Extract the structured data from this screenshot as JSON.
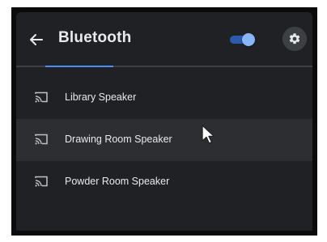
{
  "header": {
    "back_icon": "arrow-left-icon",
    "title": "Bluetooth",
    "bluetooth_enabled": true,
    "settings_icon": "gear-icon"
  },
  "colors": {
    "background": "#202124",
    "text": "#e8eaed",
    "accent": "#8ab4f8",
    "progress": "#4c8df6",
    "hover_row": "#2d2e31"
  },
  "devices": [
    {
      "label": "Library Speaker",
      "icon": "cast-icon"
    },
    {
      "label": "Drawing Room Speaker",
      "icon": "cast-icon",
      "hovered": true
    },
    {
      "label": "Powder Room Speaker",
      "icon": "cast-icon"
    }
  ]
}
